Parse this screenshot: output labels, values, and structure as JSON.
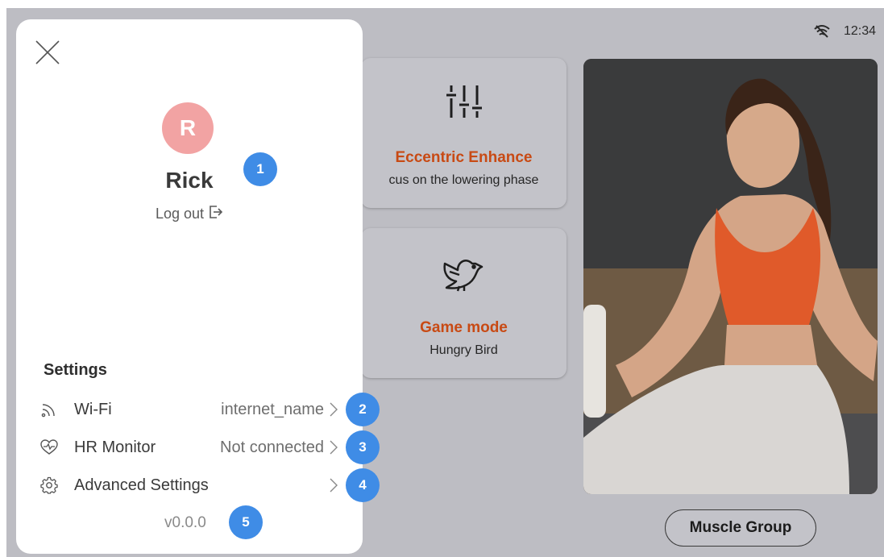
{
  "status": {
    "time": "12:34",
    "wifi_icon": "wifi-off-icon"
  },
  "cards": [
    {
      "icon": "sliders-icon",
      "title": "Eccentric Enhance",
      "subtitle": "cus on the lowering phase"
    },
    {
      "icon": "bird-icon",
      "title": "Game mode",
      "subtitle": "Hungry Bird"
    }
  ],
  "muscle_group_button": "Muscle Group",
  "panel": {
    "close_icon": "close-icon",
    "avatar_initial": "R",
    "username": "Rick",
    "logout_label": "Log out",
    "settings_title": "Settings",
    "settings": [
      {
        "icon": "wifi-icon",
        "label": "Wi-Fi",
        "value": "internet_name"
      },
      {
        "icon": "heart-rate-icon",
        "label": "HR Monitor",
        "value": "Not connected"
      },
      {
        "icon": "gear-icon",
        "label": "Advanced Settings",
        "value": ""
      }
    ],
    "version": "v0.0.0"
  },
  "badges": [
    "1",
    "2",
    "3",
    "4",
    "5"
  ],
  "colors": {
    "accent_orange": "#c84a14",
    "avatar_bg": "#f2a3a3",
    "badge_blue": "#3f8ce6",
    "overlay_gray": "#bdbdc3"
  }
}
